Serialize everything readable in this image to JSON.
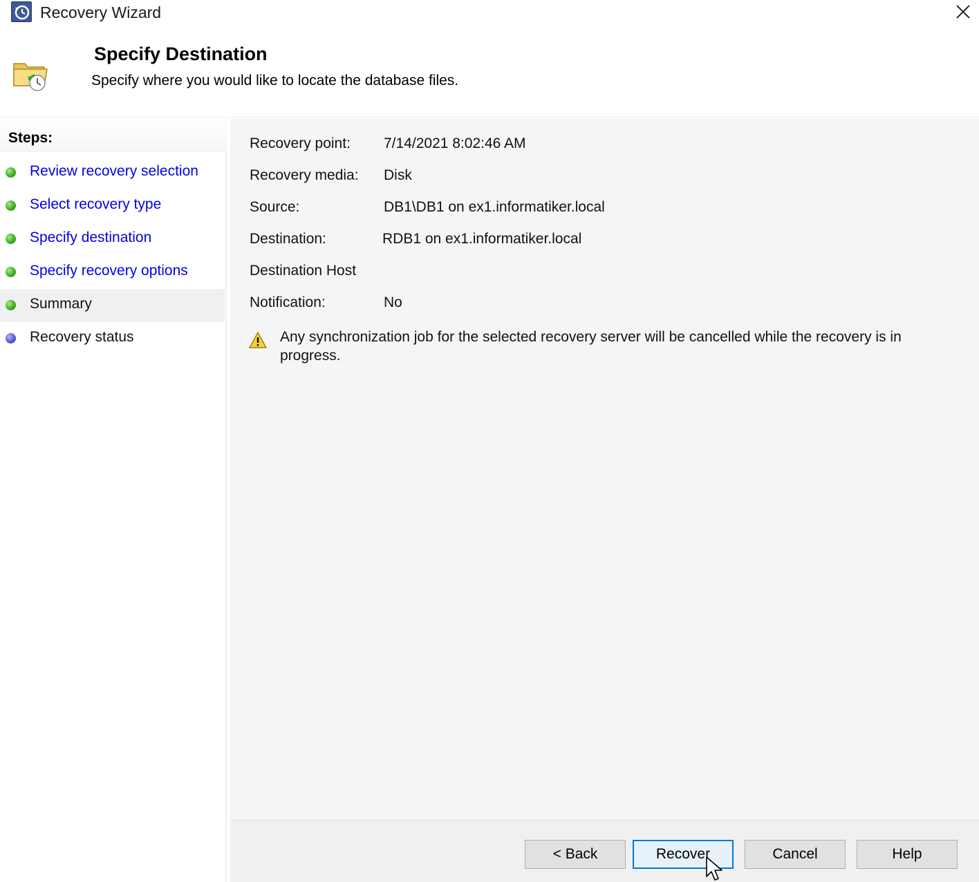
{
  "window": {
    "title": "Recovery Wizard",
    "close_icon": "close-icon"
  },
  "header": {
    "title": "Specify Destination",
    "subtitle": "Specify where you would like to locate the database files.",
    "icon": "folder-recovery-icon"
  },
  "steps": {
    "label": "Steps:",
    "items": [
      {
        "label": "Review recovery selection",
        "status": "complete",
        "link": true
      },
      {
        "label": "Select recovery type",
        "status": "complete",
        "link": true
      },
      {
        "label": "Specify destination",
        "status": "complete",
        "link": true
      },
      {
        "label": "Specify recovery options",
        "status": "complete",
        "link": true
      },
      {
        "label": "Summary",
        "status": "current",
        "link": false
      },
      {
        "label": "Recovery status",
        "status": "pending",
        "link": false
      }
    ]
  },
  "summary": {
    "recovery_point_label": "Recovery point:",
    "recovery_point_value": "7/14/2021 8:02:46 AM",
    "recovery_media_label": "Recovery media:",
    "recovery_media_value": "Disk",
    "source_label": "Source:",
    "source_value": "DB1\\DB1 on ex1.informatiker.local",
    "destination_label": "Destination:",
    "destination_value": "RDB1 on ex1.informatiker.local",
    "destination_host_label": "Destination Host",
    "notification_label": "Notification:",
    "notification_value": "No"
  },
  "warning": {
    "icon": "warning-icon",
    "text": "Any synchronization job for the selected recovery server will be cancelled while the recovery is in progress."
  },
  "buttons": {
    "back": "< Back",
    "recover": "Recover",
    "cancel": "Cancel",
    "help": "Help"
  },
  "colors": {
    "link": "#0000e6",
    "complete_bullet": "#3fae25",
    "pending_bullet": "#5a5ad6",
    "default_button_border": "#0078d7",
    "content_bg": "#f5f5f5"
  }
}
